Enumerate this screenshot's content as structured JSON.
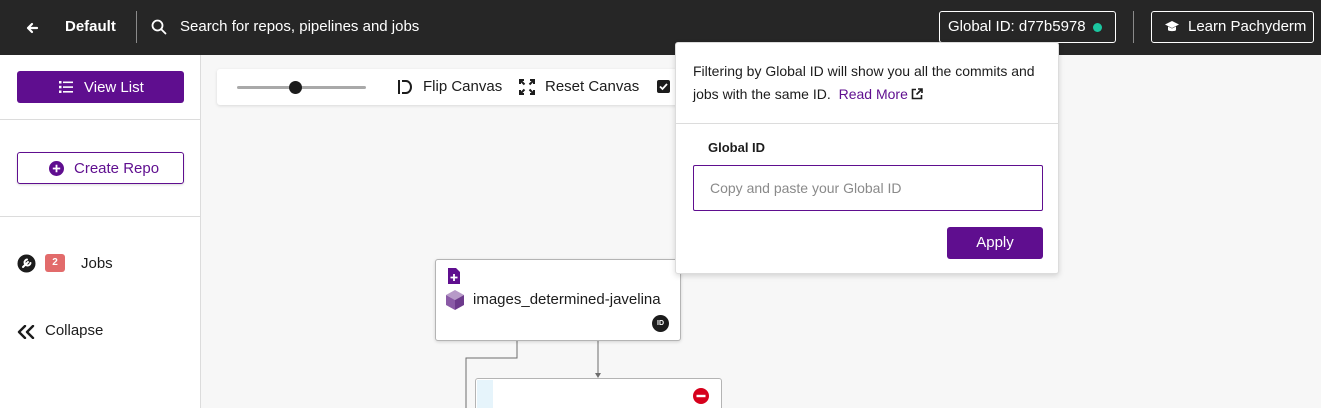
{
  "topbar": {
    "project_name": "Default",
    "search_placeholder": "Search for repos, pipelines and jobs",
    "global_id_label": "Global ID: d77b5978",
    "learn_label": "Learn Pachyderm",
    "back_icon": "arrow-left-icon",
    "search_icon": "search-icon",
    "learn_icon": "graduation-cap-icon",
    "status_color": "#1bc6a0"
  },
  "sidebar": {
    "view_list_label": "View List",
    "create_repo_label": "Create Repo",
    "jobs_label": "Jobs",
    "jobs_count": "2",
    "collapse_label": "Collapse"
  },
  "canvas_toolbar": {
    "zoom_level": 0.45,
    "flip_label": "Flip Canvas",
    "reset_label": "Reset Canvas",
    "checkbox_checked": true
  },
  "dag": {
    "node_label": "images_determined-javelina",
    "node_badge": "ID"
  },
  "popover": {
    "description": "Filtering by Global ID will show you all the commits and jobs with the same ID.",
    "read_more": "Read More",
    "field_label": "Global ID",
    "input_placeholder": "Copy and paste your Global ID",
    "input_value": "",
    "apply_label": "Apply"
  },
  "colors": {
    "topbar_bg": "#262626",
    "accent": "#5f0e8f",
    "badge_red": "#e26b6b",
    "error_red": "#d6001c"
  }
}
